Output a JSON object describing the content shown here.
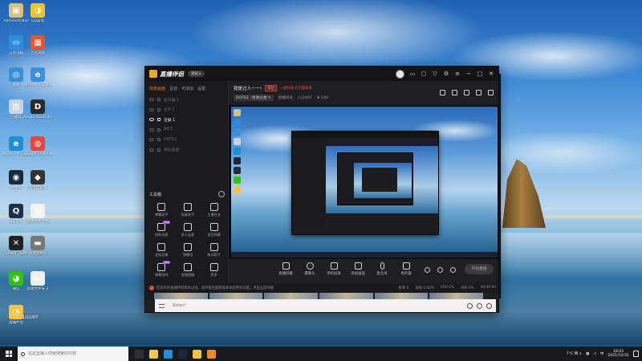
{
  "desktop": {
    "icons": [
      {
        "label": "Administrator",
        "color": "#d8c07a",
        "glyph": "▣"
      },
      {
        "label": "这台电脑",
        "color": "#2f8be0",
        "glyph": "▭"
      },
      {
        "label": "网络",
        "color": "#3a8fd6",
        "glyph": "◎"
      },
      {
        "label": "回收站",
        "color": "#c8d4e0",
        "glyph": "▥"
      },
      {
        "label": "Microsoft Edge",
        "color": "#1f8ed8",
        "glyph": "e"
      },
      {
        "label": "steam",
        "color": "#1b2838",
        "glyph": "◉"
      },
      {
        "label": "QQ音乐",
        "color": "#1b2e4a",
        "glyph": "Q"
      },
      {
        "label": "Grand Theft",
        "color": "#222",
        "glyph": "✕"
      },
      {
        "label": "微信",
        "color": "#2dc100",
        "glyph": "◕"
      },
      {
        "label": "直播伴侣",
        "color": "#f5c343",
        "glyph": "◔"
      },
      {
        "label": "QQ游戏",
        "color": "#f2c12e",
        "glyph": "◑"
      },
      {
        "label": "百度网盘",
        "color": "#e8542b",
        "glyph": "▦"
      },
      {
        "label": "Internet Explorer",
        "color": "#3a8fe0",
        "glyph": "e"
      },
      {
        "label": "Adobe Illustrator",
        "color": "#2b2b2b",
        "glyph": "D"
      },
      {
        "label": "Google Chrome",
        "color": "#e9453a",
        "glyph": "◍"
      },
      {
        "label": "黑神话游戏",
        "color": "#333",
        "glyph": "◆"
      },
      {
        "label": "新建文本文档",
        "color": "#f2f2f2",
        "glyph": "▤"
      },
      {
        "label": "新建文件夹",
        "color": "#777",
        "glyph": "▬"
      },
      {
        "label": "新建文件夹 2",
        "color": "#f0f0f0",
        "glyph": "▭"
      }
    ],
    "watermark_line1": "",
    "watermark_line2": "1/12/07"
  },
  "app": {
    "title": "直播伴侣",
    "version": "测试 ▸",
    "left_tabs": [
      "场景画面",
      "互动",
      "可添加",
      "设置"
    ],
    "scenes": [
      {
        "label": "显示器 1",
        "selected": false
      },
      {
        "label": "文字 1",
        "selected": false
      },
      {
        "label": "全屏 1",
        "selected": true
      },
      {
        "label": "NICK",
        "selected": false
      },
      {
        "label": "DOTA2",
        "selected": false
      },
      {
        "label": "添加画面",
        "selected": false
      }
    ],
    "tools_label": "工具箱",
    "tools": [
      {
        "label": "弹幕助手",
        "badge": ""
      },
      {
        "label": "观看助手",
        "badge": ""
      },
      {
        "label": "主播任务",
        "badge": ""
      },
      {
        "label": "抢购连麦",
        "badge": "NEW"
      },
      {
        "label": "多人连麦",
        "badge": ""
      },
      {
        "label": "语音弹幕",
        "badge": ""
      },
      {
        "label": "虚拟形象",
        "badge": ""
      },
      {
        "label": "弹幕墙",
        "badge": ""
      },
      {
        "label": "歌词助手",
        "badge": ""
      },
      {
        "label": "弹幕游戏",
        "badge": "NEW"
      },
      {
        "label": "直播提醒",
        "badge": ""
      },
      {
        "label": "更多",
        "badge": ""
      }
    ],
    "room": {
      "title": "我是过人一一!",
      "tag": "排位",
      "notice": "一键开播 有问题联系",
      "game": "DOTA2 · 修改分类 ✎",
      "stat1": "直播间号",
      "stat2": "112407",
      "viewers": "♛ 140"
    },
    "controls": [
      {
        "label": "直播屏幕"
      },
      {
        "label": "摄像头"
      },
      {
        "label": "手机投屏"
      },
      {
        "label": "添加画面"
      },
      {
        "label": "麦克风"
      },
      {
        "label": "扬声器"
      }
    ],
    "start_button": "开始直播",
    "status_message": "您安装的直播伴侣版本过低，请升级至最新版本体验更多功能，点击立即升级",
    "status_right": [
      "帧率 0",
      "丢帧 0.00%",
      "CPU 0%",
      "内存 0%"
    ],
    "status_time": "00:00:00",
    "chat_placeholder": "Aidan!"
  },
  "taskbar": {
    "search_placeholder": "在这里输入你要搜索的内容",
    "apps": [
      {
        "name": "task-view",
        "color": "#2b2f36"
      },
      {
        "name": "file-explorer",
        "color": "#f2c94c"
      },
      {
        "name": "edge",
        "color": "#1e8fd8"
      },
      {
        "name": "steam",
        "color": "#1b2838"
      },
      {
        "name": "qq",
        "color": "#f5c343"
      },
      {
        "name": "live-companion",
        "color": "#f08a24"
      }
    ],
    "temperature": "7°C 晴 ∧",
    "lang": "中",
    "time": "18:01",
    "date": "2021/12/31"
  }
}
